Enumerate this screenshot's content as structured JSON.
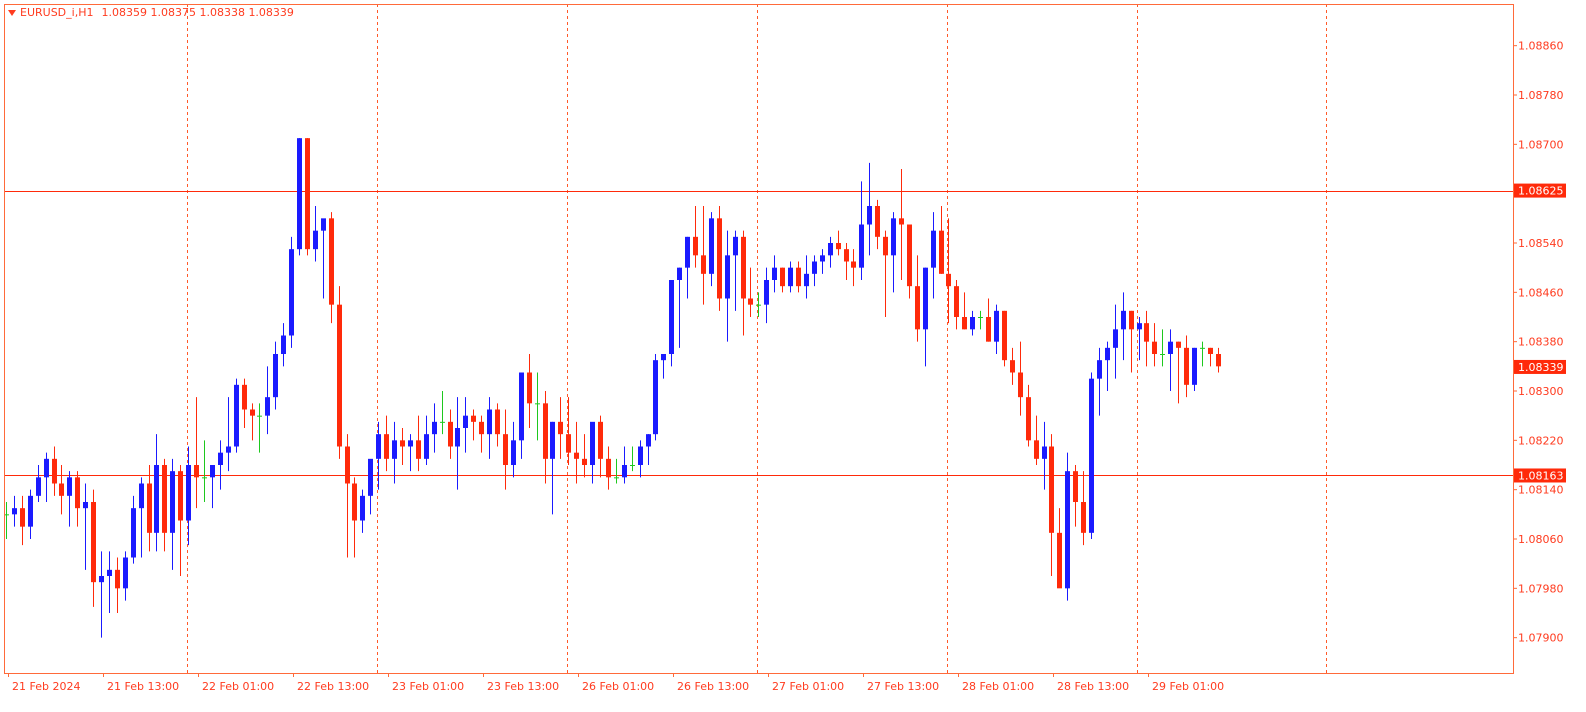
{
  "colors": {
    "frame": "#ff6a3a",
    "grid": "#ff5a2a",
    "axis_text": "#ff3b1f",
    "bull": "#1a1aff",
    "bear": "#ff2a0a",
    "doji": "#1ec81e",
    "hline": "#ff2a0a",
    "badge_bg": "#ff2a0a",
    "badge_text": "#ffffff"
  },
  "header": {
    "symbol_timeframe": "EURUSD_i,H1",
    "ohlc": "1.08359 1.08375 1.08338 1.08339"
  },
  "chart_data": {
    "type": "candlestick",
    "symbol": "EURUSD_i",
    "timeframe": "H1",
    "ylim": [
      1.0788,
      1.089
    ],
    "y_ticks": [
      "1.08860",
      "1.08780",
      "1.08700",
      "1.08540",
      "1.08460",
      "1.08380",
      "1.08300",
      "1.08220",
      "1.08140",
      "1.08060",
      "1.07980",
      "1.07900"
    ],
    "x_labels": [
      "21 Feb 2024",
      "21 Feb 13:00",
      "22 Feb 01:00",
      "22 Feb 13:00",
      "23 Feb 01:00",
      "23 Feb 13:00",
      "26 Feb 01:00",
      "26 Feb 13:00",
      "27 Feb 01:00",
      "27 Feb 13:00",
      "28 Feb 01:00",
      "28 Feb 13:00",
      "29 Feb 01:00"
    ],
    "horizontal_lines": [
      {
        "price": 1.08625,
        "label": "1.08625"
      },
      {
        "price": 1.08163,
        "label": "1.08163"
      }
    ],
    "current_price": {
      "price": 1.08339,
      "label": "1.08339"
    },
    "period_separators": 7,
    "candles": [
      [
        1.081,
        1.0812,
        1.0806,
        1.081
      ],
      [
        1.081,
        1.0813,
        1.0808,
        1.0811
      ],
      [
        1.0811,
        1.0813,
        1.0805,
        1.0808
      ],
      [
        1.0808,
        1.0814,
        1.0806,
        1.0813
      ],
      [
        1.0813,
        1.0818,
        1.0812,
        1.0816
      ],
      [
        1.0816,
        1.082,
        1.0812,
        1.0819
      ],
      [
        1.0819,
        1.0821,
        1.0813,
        1.0815
      ],
      [
        1.0815,
        1.0818,
        1.081,
        1.0813
      ],
      [
        1.0813,
        1.0817,
        1.0808,
        1.0816
      ],
      [
        1.0816,
        1.0817,
        1.0808,
        1.0811
      ],
      [
        1.0811,
        1.0815,
        1.0801,
        1.0812
      ],
      [
        1.0812,
        1.0814,
        1.0795,
        1.0799
      ],
      [
        1.0799,
        1.0804,
        1.079,
        1.08
      ],
      [
        1.08,
        1.0804,
        1.0794,
        1.0801
      ],
      [
        1.0801,
        1.0803,
        1.0794,
        1.0798
      ],
      [
        1.0798,
        1.0804,
        1.0796,
        1.0803
      ],
      [
        1.0803,
        1.0813,
        1.0802,
        1.0811
      ],
      [
        1.0811,
        1.0816,
        1.0803,
        1.0815
      ],
      [
        1.0815,
        1.0818,
        1.0804,
        1.0807
      ],
      [
        1.0807,
        1.0823,
        1.0804,
        1.0818
      ],
      [
        1.0818,
        1.0819,
        1.0804,
        1.0807
      ],
      [
        1.0807,
        1.0819,
        1.0801,
        1.0817
      ],
      [
        1.0817,
        1.0818,
        1.08,
        1.0809
      ],
      [
        1.0809,
        1.0821,
        1.0805,
        1.0818
      ],
      [
        1.0818,
        1.0829,
        1.0811,
        1.0816
      ],
      [
        1.0816,
        1.0822,
        1.0812,
        1.0816
      ],
      [
        1.0816,
        1.0818,
        1.0811,
        1.0818
      ],
      [
        1.0818,
        1.0822,
        1.0814,
        1.082
      ],
      [
        1.082,
        1.0829,
        1.0817,
        1.0821
      ],
      [
        1.0821,
        1.0832,
        1.082,
        1.0831
      ],
      [
        1.0831,
        1.0832,
        1.0824,
        1.0827
      ],
      [
        1.0827,
        1.0828,
        1.0822,
        1.0826
      ],
      [
        1.0826,
        1.0828,
        1.082,
        1.0826
      ],
      [
        1.0826,
        1.0834,
        1.0823,
        1.0829
      ],
      [
        1.0829,
        1.0838,
        1.0827,
        1.0836
      ],
      [
        1.0836,
        1.0841,
        1.0834,
        1.0839
      ],
      [
        1.0839,
        1.0855,
        1.0837,
        1.0853
      ],
      [
        1.0853,
        1.0871,
        1.0852,
        1.0871
      ],
      [
        1.0871,
        1.0871,
        1.0852,
        1.0853
      ],
      [
        1.0853,
        1.086,
        1.0851,
        1.0856
      ],
      [
        1.0856,
        1.0857,
        1.0845,
        1.0858
      ],
      [
        1.0858,
        1.0859,
        1.0841,
        1.0844
      ],
      [
        1.0844,
        1.0847,
        1.0819,
        1.0821
      ],
      [
        1.0821,
        1.0823,
        1.0803,
        1.0815
      ],
      [
        1.0815,
        1.0816,
        1.0803,
        1.0809
      ],
      [
        1.0809,
        1.0814,
        1.0807,
        1.0813
      ],
      [
        1.0813,
        1.0816,
        1.081,
        1.0819
      ],
      [
        1.0819,
        1.0825,
        1.0814,
        1.0823
      ],
      [
        1.0823,
        1.0826,
        1.0817,
        1.0819
      ],
      [
        1.0819,
        1.0825,
        1.0815,
        1.0822
      ],
      [
        1.0822,
        1.0824,
        1.0818,
        1.0821
      ],
      [
        1.0821,
        1.0823,
        1.0817,
        1.0822
      ],
      [
        1.0822,
        1.0826,
        1.0817,
        1.0819
      ],
      [
        1.0819,
        1.0826,
        1.0818,
        1.0823
      ],
      [
        1.0823,
        1.0828,
        1.082,
        1.0825
      ],
      [
        1.0825,
        1.083,
        1.0823,
        1.0825
      ],
      [
        1.0825,
        1.0827,
        1.0819,
        1.0821
      ],
      [
        1.0821,
        1.0829,
        1.0814,
        1.0824
      ],
      [
        1.0824,
        1.0829,
        1.082,
        1.0826
      ],
      [
        1.0826,
        1.0827,
        1.0822,
        1.0825
      ],
      [
        1.0825,
        1.0826,
        1.082,
        1.0823
      ],
      [
        1.0823,
        1.0829,
        1.0819,
        1.0827
      ],
      [
        1.0827,
        1.0828,
        1.0821,
        1.0823
      ],
      [
        1.0823,
        1.0827,
        1.0814,
        1.0818
      ],
      [
        1.0818,
        1.0825,
        1.0816,
        1.0822
      ],
      [
        1.0822,
        1.0833,
        1.0819,
        1.0833
      ],
      [
        1.0833,
        1.0836,
        1.0824,
        1.0828
      ],
      [
        1.0828,
        1.0833,
        1.0822,
        1.0828
      ],
      [
        1.0828,
        1.083,
        1.0815,
        1.0819
      ],
      [
        1.0819,
        1.0825,
        1.081,
        1.0825
      ],
      [
        1.0825,
        1.0829,
        1.0819,
        1.0823
      ],
      [
        1.0823,
        1.0829,
        1.0818,
        1.082
      ],
      [
        1.082,
        1.0825,
        1.0815,
        1.0819
      ],
      [
        1.0819,
        1.0823,
        1.0816,
        1.0818
      ],
      [
        1.0818,
        1.0822,
        1.0815,
        1.0825
      ],
      [
        1.0825,
        1.0826,
        1.0816,
        1.0819
      ],
      [
        1.0819,
        1.0821,
        1.0814,
        1.0816
      ],
      [
        1.0816,
        1.0819,
        1.0815,
        1.0816
      ],
      [
        1.0816,
        1.0821,
        1.0815,
        1.0818
      ],
      [
        1.0818,
        1.0821,
        1.0817,
        1.0818
      ],
      [
        1.0818,
        1.0822,
        1.0816,
        1.0821
      ],
      [
        1.0821,
        1.0823,
        1.0818,
        1.0823
      ],
      [
        1.0823,
        1.0836,
        1.0822,
        1.0835
      ],
      [
        1.0835,
        1.0836,
        1.0832,
        1.0836
      ],
      [
        1.0836,
        1.084,
        1.0834,
        1.0848
      ],
      [
        1.0848,
        1.085,
        1.0837,
        1.085
      ],
      [
        1.085,
        1.0855,
        1.0845,
        1.0855
      ],
      [
        1.0855,
        1.086,
        1.085,
        1.0852
      ],
      [
        1.0852,
        1.086,
        1.0844,
        1.0849
      ],
      [
        1.0849,
        1.0859,
        1.0847,
        1.0858
      ],
      [
        1.0858,
        1.086,
        1.0843,
        1.0845
      ],
      [
        1.0845,
        1.0856,
        1.0838,
        1.0852
      ],
      [
        1.0852,
        1.0856,
        1.0843,
        1.0855
      ],
      [
        1.0855,
        1.0856,
        1.0839,
        1.0845
      ],
      [
        1.0845,
        1.085,
        1.0842,
        1.0844
      ],
      [
        1.0844,
        1.0846,
        1.0842,
        1.0844
      ],
      [
        1.0844,
        1.085,
        1.0841,
        1.0848
      ],
      [
        1.0848,
        1.0852,
        1.0846,
        1.085
      ],
      [
        1.085,
        1.085,
        1.0846,
        1.0847
      ],
      [
        1.0847,
        1.0851,
        1.0846,
        1.085
      ],
      [
        1.085,
        1.0851,
        1.0846,
        1.0847
      ],
      [
        1.0847,
        1.0852,
        1.0845,
        1.0849
      ],
      [
        1.0849,
        1.0852,
        1.0847,
        1.0851
      ],
      [
        1.0851,
        1.0853,
        1.0849,
        1.0852
      ],
      [
        1.0852,
        1.0855,
        1.085,
        1.0854
      ],
      [
        1.0854,
        1.0856,
        1.0852,
        1.0853
      ],
      [
        1.0853,
        1.0854,
        1.0848,
        1.0851
      ],
      [
        1.0851,
        1.0853,
        1.0847,
        1.085
      ],
      [
        1.085,
        1.0864,
        1.0848,
        1.0857
      ],
      [
        1.0857,
        1.0867,
        1.0852,
        1.086
      ],
      [
        1.086,
        1.0861,
        1.0853,
        1.0855
      ],
      [
        1.0855,
        1.0856,
        1.0842,
        1.0852
      ],
      [
        1.0852,
        1.0859,
        1.0846,
        1.0858
      ],
      [
        1.0858,
        1.0866,
        1.0848,
        1.0857
      ],
      [
        1.0857,
        1.0857,
        1.0845,
        1.0847
      ],
      [
        1.0847,
        1.0852,
        1.0838,
        1.084
      ],
      [
        1.084,
        1.085,
        1.0834,
        1.085
      ],
      [
        1.085,
        1.0859,
        1.0845,
        1.0856
      ],
      [
        1.0856,
        1.086,
        1.0849,
        1.0849
      ],
      [
        1.0849,
        1.0858,
        1.0841,
        1.0847
      ],
      [
        1.0847,
        1.0848,
        1.084,
        1.0842
      ],
      [
        1.0842,
        1.0846,
        1.084,
        1.084
      ],
      [
        1.084,
        1.0843,
        1.0839,
        1.0842
      ],
      [
        1.0842,
        1.0843,
        1.084,
        1.0842
      ],
      [
        1.0842,
        1.0845,
        1.0838,
        1.0838
      ],
      [
        1.0838,
        1.0844,
        1.0836,
        1.0843
      ],
      [
        1.0843,
        1.0843,
        1.0834,
        1.0835
      ],
      [
        1.0835,
        1.0837,
        1.0831,
        1.0833
      ],
      [
        1.0833,
        1.0838,
        1.0826,
        1.0829
      ],
      [
        1.0829,
        1.0831,
        1.0821,
        1.0822
      ],
      [
        1.0822,
        1.0826,
        1.0818,
        1.0819
      ],
      [
        1.0819,
        1.0825,
        1.0814,
        1.0821
      ],
      [
        1.0821,
        1.0823,
        1.08,
        1.0807
      ],
      [
        1.0807,
        1.0811,
        1.0799,
        1.0798
      ],
      [
        1.0798,
        1.082,
        1.0796,
        1.0817
      ],
      [
        1.0817,
        1.0818,
        1.0808,
        1.0812
      ],
      [
        1.0812,
        1.0817,
        1.0805,
        1.0807
      ],
      [
        1.0807,
        1.0833,
        1.0806,
        1.0832
      ],
      [
        1.0832,
        1.0837,
        1.0826,
        1.0835
      ],
      [
        1.0835,
        1.0838,
        1.083,
        1.0837
      ],
      [
        1.0837,
        1.0844,
        1.0832,
        1.084
      ],
      [
        1.084,
        1.0846,
        1.0835,
        1.0843
      ],
      [
        1.0843,
        1.0843,
        1.0833,
        1.084
      ],
      [
        1.084,
        1.0842,
        1.0835,
        1.0841
      ],
      [
        1.0841,
        1.0843,
        1.0834,
        1.0838
      ],
      [
        1.0838,
        1.0841,
        1.0834,
        1.0836
      ],
      [
        1.0836,
        1.084,
        1.0834,
        1.0836
      ],
      [
        1.0836,
        1.084,
        1.083,
        1.0838
      ],
      [
        1.0838,
        1.0838,
        1.0828,
        1.0837
      ],
      [
        1.0837,
        1.0839,
        1.0829,
        1.0831
      ],
      [
        1.0831,
        1.0837,
        1.083,
        1.0837
      ],
      [
        1.0837,
        1.0838,
        1.0834,
        1.0837
      ],
      [
        1.0837,
        1.0837,
        1.0834,
        1.0836
      ],
      [
        1.0836,
        1.0837,
        1.0833,
        1.0834
      ]
    ]
  }
}
